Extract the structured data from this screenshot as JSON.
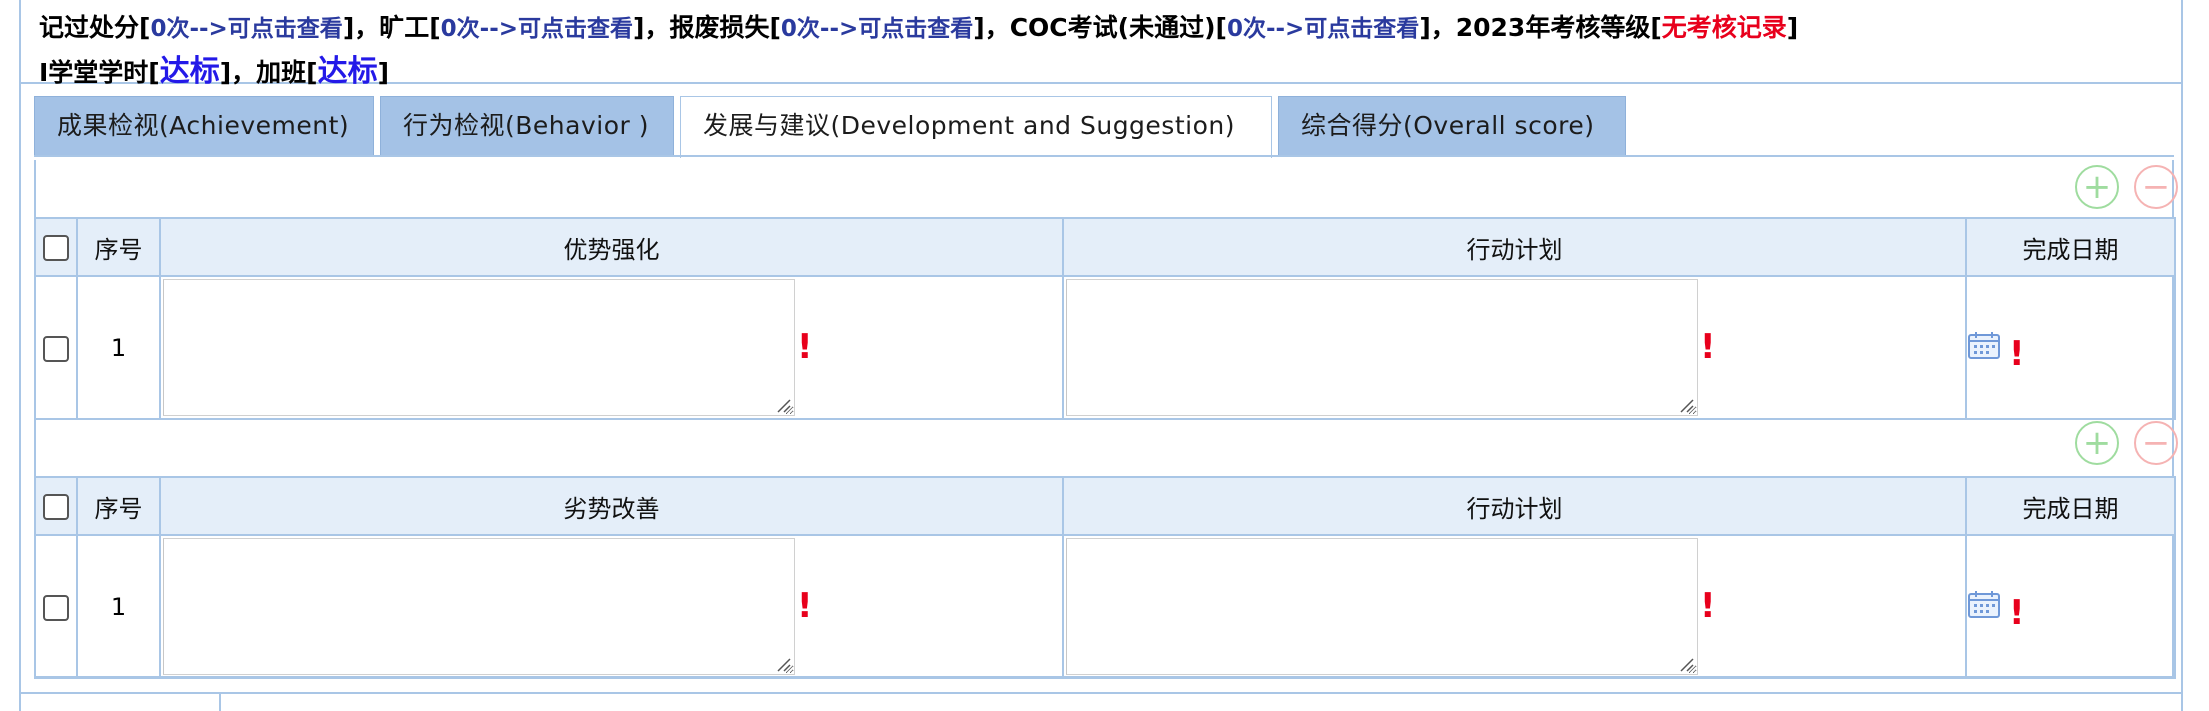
{
  "summary": {
    "l1_a": "记过处分[",
    "l1_a_link": "0次-->可点击查看",
    "l1_b": "]，旷工[",
    "l1_b_link": "0次-->可点击查看",
    "l1_c": "]，报废损失[",
    "l1_c_link": "0次-->可点击查看",
    "l1_d": "]，COC考试(未通过)[",
    "l1_d_link": "0次-->可点击查看",
    "l1_e": "]，2023年考核等级[",
    "l1_e_red": "无考核记录",
    "l1_f": "]",
    "l2_a": "I学堂学时[",
    "l2_a_blue": "达标",
    "l2_b": "]，加班[",
    "l2_b_blue": "达标",
    "l2_c": "]"
  },
  "tabs": [
    {
      "label": "成果检视(Achievement)"
    },
    {
      "label": "行为检视(Behavior )"
    },
    {
      "label": "发展与建议(Development and Suggestion)",
      "active": true
    },
    {
      "label": "综合得分(Overall score)"
    }
  ],
  "controls": {
    "add_icon": "plus-circle-icon",
    "remove_icon": "minus-circle-icon",
    "add_glyph": "+",
    "remove_glyph": "−"
  },
  "table1": {
    "headers": {
      "seq": "序号",
      "col1": "优势强化",
      "col2": "行动计划",
      "col3": "完成日期"
    },
    "rows": [
      {
        "seq": "1",
        "col1": "",
        "col2": ""
      }
    ]
  },
  "table2": {
    "headers": {
      "seq": "序号",
      "col1": "劣势改善",
      "col2": "行动计划",
      "col3": "完成日期"
    },
    "rows": [
      {
        "seq": "1",
        "col1": "",
        "col2": ""
      }
    ]
  },
  "required_mark": "!",
  "colors": {
    "tab_bg": "#a4c2e6",
    "border": "#a9c6e6",
    "header_bg": "#e4eef9",
    "link": "#2a3a9e",
    "required": "#e8001c",
    "add": "#9fdc9f",
    "remove": "#f5b3b3"
  }
}
